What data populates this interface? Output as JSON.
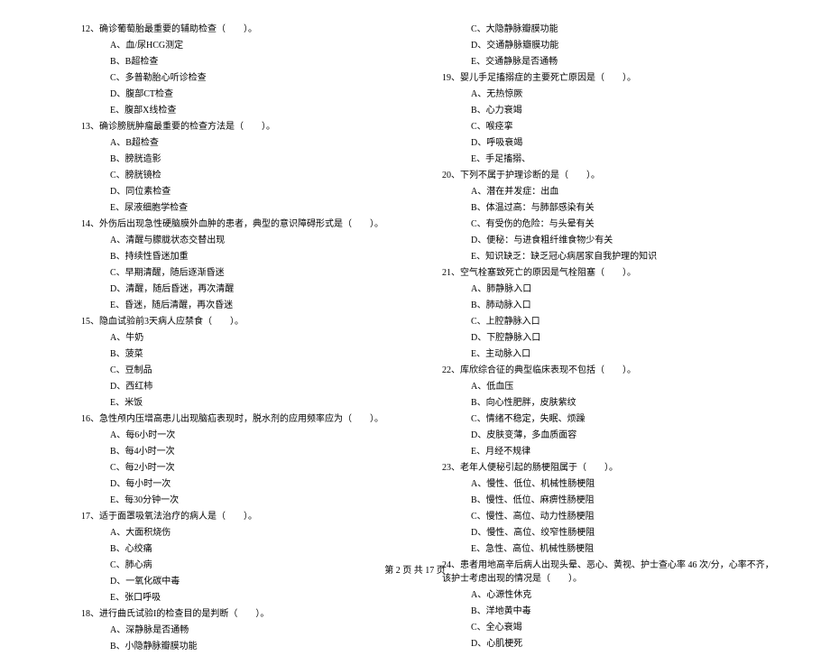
{
  "left": [
    {
      "t": "q",
      "text": "12、确诊葡萄胎最重要的辅助检查（　　）。"
    },
    {
      "t": "o",
      "text": "A、血/尿HCG测定"
    },
    {
      "t": "o",
      "text": "B、B超检查"
    },
    {
      "t": "o",
      "text": "C、多普勒胎心听诊检查"
    },
    {
      "t": "o",
      "text": "D、腹部CT检查"
    },
    {
      "t": "o",
      "text": "E、腹部X线检查"
    },
    {
      "t": "q",
      "text": "13、确诊膀胱肿瘤最重要的检查方法是（　　）。"
    },
    {
      "t": "o",
      "text": "A、B超检查"
    },
    {
      "t": "o",
      "text": "B、膀胱造影"
    },
    {
      "t": "o",
      "text": "C、膀胱镜检"
    },
    {
      "t": "o",
      "text": "D、同位素检查"
    },
    {
      "t": "o",
      "text": "E、尿液细胞学检查"
    },
    {
      "t": "q",
      "text": "14、外伤后出现急性硬脑膜外血肿的患者，典型的意识障碍形式是（　　）。"
    },
    {
      "t": "o",
      "text": "A、清醒与朦胧状态交替出现"
    },
    {
      "t": "o",
      "text": "B、持续性昏迷加重"
    },
    {
      "t": "o",
      "text": "C、早期清醒，随后逐渐昏迷"
    },
    {
      "t": "o",
      "text": "D、清醒，随后昏迷，再次清醒"
    },
    {
      "t": "o",
      "text": "E、昏迷，随后清醒，再次昏迷"
    },
    {
      "t": "q",
      "text": "15、隐血试验前3天病人应禁食（　　）。"
    },
    {
      "t": "o",
      "text": "A、牛奶"
    },
    {
      "t": "o",
      "text": "B、菠菜"
    },
    {
      "t": "o",
      "text": "C、豆制品"
    },
    {
      "t": "o",
      "text": "D、西红柿"
    },
    {
      "t": "o",
      "text": "E、米饭"
    },
    {
      "t": "q",
      "text": "16、急性颅内压增高患儿出现脑疝表现时，脱水剂的应用频率应为（　　）。"
    },
    {
      "t": "o",
      "text": "A、每6小时一次"
    },
    {
      "t": "o",
      "text": "B、每4小时一次"
    },
    {
      "t": "o",
      "text": "C、每2小时一次"
    },
    {
      "t": "o",
      "text": "D、每小时一次"
    },
    {
      "t": "o",
      "text": "E、每30分钟一次"
    },
    {
      "t": "q",
      "text": "17、适于面罩吸氧法治疗的病人是（　　）。"
    },
    {
      "t": "o",
      "text": "A、大面积烧伤"
    },
    {
      "t": "o",
      "text": "B、心绞痛"
    },
    {
      "t": "o",
      "text": "C、肺心病"
    },
    {
      "t": "o",
      "text": "D、一氧化碳中毒"
    },
    {
      "t": "o",
      "text": "E、张口呼吸"
    },
    {
      "t": "q",
      "text": "18、进行曲氏试验I的检查目的是判断（　　）。"
    },
    {
      "t": "o",
      "text": "A、深静脉是否通畅"
    },
    {
      "t": "o",
      "text": "B、小隐静脉瓣膜功能"
    }
  ],
  "right": [
    {
      "t": "o",
      "text": "C、大隐静脉瓣膜功能"
    },
    {
      "t": "o",
      "text": "D、交通静脉瓣膜功能"
    },
    {
      "t": "o",
      "text": "E、交通静脉是否通畅"
    },
    {
      "t": "q",
      "text": "19、婴儿手足搐搦症的主要死亡原因是（　　）。"
    },
    {
      "t": "o",
      "text": "A、无热惊厥"
    },
    {
      "t": "o",
      "text": "B、心力衰竭"
    },
    {
      "t": "o",
      "text": "C、喉痉挛"
    },
    {
      "t": "o",
      "text": "D、呼吸衰竭"
    },
    {
      "t": "o",
      "text": "E、手足搐搦、"
    },
    {
      "t": "q",
      "text": "20、下列不属于护理诊断的是（　　）。"
    },
    {
      "t": "o",
      "text": "A、潜在并发症：出血"
    },
    {
      "t": "o",
      "text": "B、体温过高：与肺部感染有关"
    },
    {
      "t": "o",
      "text": "C、有受伤的危险：与头晕有关"
    },
    {
      "t": "o",
      "text": "D、便秘：与进食粗纤维食物少有关"
    },
    {
      "t": "o",
      "text": "E、知识缺乏：缺乏冠心病居家自我护理的知识"
    },
    {
      "t": "q",
      "text": "21、空气栓塞致死亡的原因是气栓阻塞（　　）。"
    },
    {
      "t": "o",
      "text": "A、肺静脉入口"
    },
    {
      "t": "o",
      "text": "B、肺动脉入口"
    },
    {
      "t": "o",
      "text": "C、上腔静脉入口"
    },
    {
      "t": "o",
      "text": "D、下腔静脉入口"
    },
    {
      "t": "o",
      "text": "E、主动脉入口"
    },
    {
      "t": "q",
      "text": "22、库欣综合征的典型临床表现不包括（　　）。"
    },
    {
      "t": "o",
      "text": "A、低血压"
    },
    {
      "t": "o",
      "text": "B、向心性肥胖，皮肤紫纹"
    },
    {
      "t": "o",
      "text": "C、情绪不稳定，失眠、烦躁"
    },
    {
      "t": "o",
      "text": "D、皮肤变薄，多血质面容"
    },
    {
      "t": "o",
      "text": "E、月经不规律"
    },
    {
      "t": "q",
      "text": "23、老年人便秘引起的肠梗阻属于（　　）。"
    },
    {
      "t": "o",
      "text": "A、慢性、低位、机械性肠梗阻"
    },
    {
      "t": "o",
      "text": "B、慢性、低位、麻痹性肠梗阻"
    },
    {
      "t": "o",
      "text": "C、慢性、高位、动力性肠梗阻"
    },
    {
      "t": "o",
      "text": "D、慢性、高位、绞窄性肠梗阻"
    },
    {
      "t": "o",
      "text": "E、急性、高位、机械性肠梗阻"
    },
    {
      "t": "q",
      "text": "24、患者用地高辛后病人出现头晕、恶心、黄视、护士查心率 46 次/分，心率不齐，该护士考虑出现的情况是（　　）。"
    },
    {
      "t": "o",
      "text": "A、心源性休克"
    },
    {
      "t": "o",
      "text": "B、洋地黄中毒"
    },
    {
      "t": "o",
      "text": "C、全心衰竭"
    },
    {
      "t": "o",
      "text": "D、心肌梗死"
    }
  ],
  "footer": "第 2 页 共 17 页"
}
